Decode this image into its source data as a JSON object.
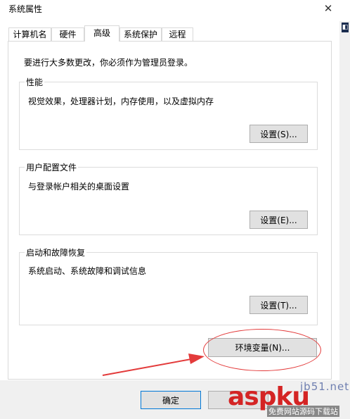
{
  "window": {
    "title": "系统属性",
    "close_glyph": "✕"
  },
  "tabs": [
    {
      "label": "计算机名",
      "selected": false
    },
    {
      "label": "硬件",
      "selected": false
    },
    {
      "label": "高级",
      "selected": true
    },
    {
      "label": "系统保护",
      "selected": false
    },
    {
      "label": "远程",
      "selected": false
    }
  ],
  "admin_note": "要进行大多数更改，你必须作为管理员登录。",
  "performance": {
    "title": "性能",
    "description": "视觉效果，处理器计划，内存使用，以及虚拟内存",
    "button": "设置(S)..."
  },
  "user_profiles": {
    "title": "用户配置文件",
    "description": "与登录帐户相关的桌面设置",
    "button": "设置(E)..."
  },
  "startup_recovery": {
    "title": "启动和故障恢复",
    "description": "系统启动、系统故障和调试信息",
    "button": "设置(T)..."
  },
  "env_button": "环境变量(N)...",
  "footer": {
    "ok": "确定",
    "cancel": ""
  },
  "watermark": {
    "site": "jb51.net",
    "brand": "aspku",
    "sub": "免费网站源码下载站"
  },
  "colors": {
    "annotation_red": "#e33b3b",
    "accent_blue": "#0078d7"
  }
}
